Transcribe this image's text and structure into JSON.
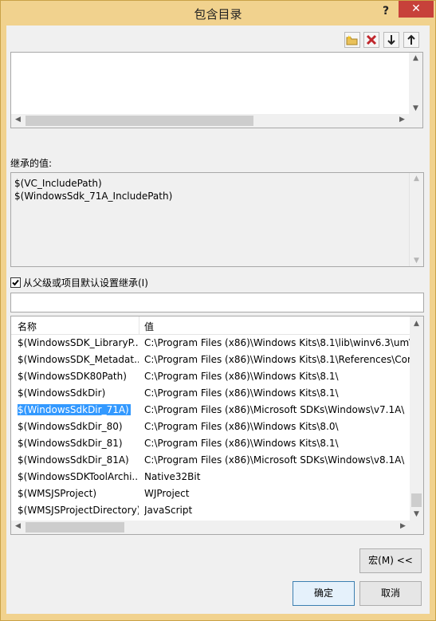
{
  "window": {
    "title": "包含目录",
    "help_glyph": "?",
    "close_glyph": "✕"
  },
  "toolbar": {
    "new_line_icon": "new-folder-icon",
    "delete_icon": "delete-x-icon",
    "down_icon": "move-down-icon",
    "up_icon": "move-up-icon"
  },
  "inherited": {
    "label": "继承的值:",
    "values": [
      "$(VC_IncludePath)",
      "$(WindowsSdk_71A_IncludePath)"
    ]
  },
  "inherit_checkbox": {
    "checked": true,
    "label": "从父级或项目默认设置继承(I)"
  },
  "filter": {
    "value": ""
  },
  "macros": {
    "headers": [
      "名称",
      "值"
    ],
    "rows": [
      {
        "name": "$(WindowsSDK_LibraryP...",
        "value": "C:\\Program Files (x86)\\Windows Kits\\8.1\\lib\\winv6.3\\um\\x"
      },
      {
        "name": "$(WindowsSDK_Metadat...",
        "value": "C:\\Program Files (x86)\\Windows Kits\\8.1\\References\\Com"
      },
      {
        "name": "$(WindowsSDK80Path)",
        "value": "C:\\Program Files (x86)\\Windows Kits\\8.1\\"
      },
      {
        "name": "$(WindowsSdkDir)",
        "value": "C:\\Program Files (x86)\\Windows Kits\\8.1\\"
      },
      {
        "name": "$(WindowsSdkDir_71A)",
        "value": "C:\\Program Files (x86)\\Microsoft SDKs\\Windows\\v7.1A\\"
      },
      {
        "name": "$(WindowsSdkDir_80)",
        "value": "C:\\Program Files (x86)\\Windows Kits\\8.0\\"
      },
      {
        "name": "$(WindowsSdkDir_81)",
        "value": "C:\\Program Files (x86)\\Windows Kits\\8.1\\"
      },
      {
        "name": "$(WindowsSdkDir_81A)",
        "value": "C:\\Program Files (x86)\\Microsoft SDKs\\Windows\\v8.1A\\"
      },
      {
        "name": "$(WindowsSDKToolArchi...",
        "value": "Native32Bit"
      },
      {
        "name": "$(WMSJSProject)",
        "value": "WJProject"
      },
      {
        "name": "$(WMSJSProjectDirectory)",
        "value": "JavaScript"
      }
    ],
    "selected_index": 4
  },
  "buttons": {
    "macros": "宏(M) <<",
    "ok": "确定",
    "cancel": "取消"
  }
}
